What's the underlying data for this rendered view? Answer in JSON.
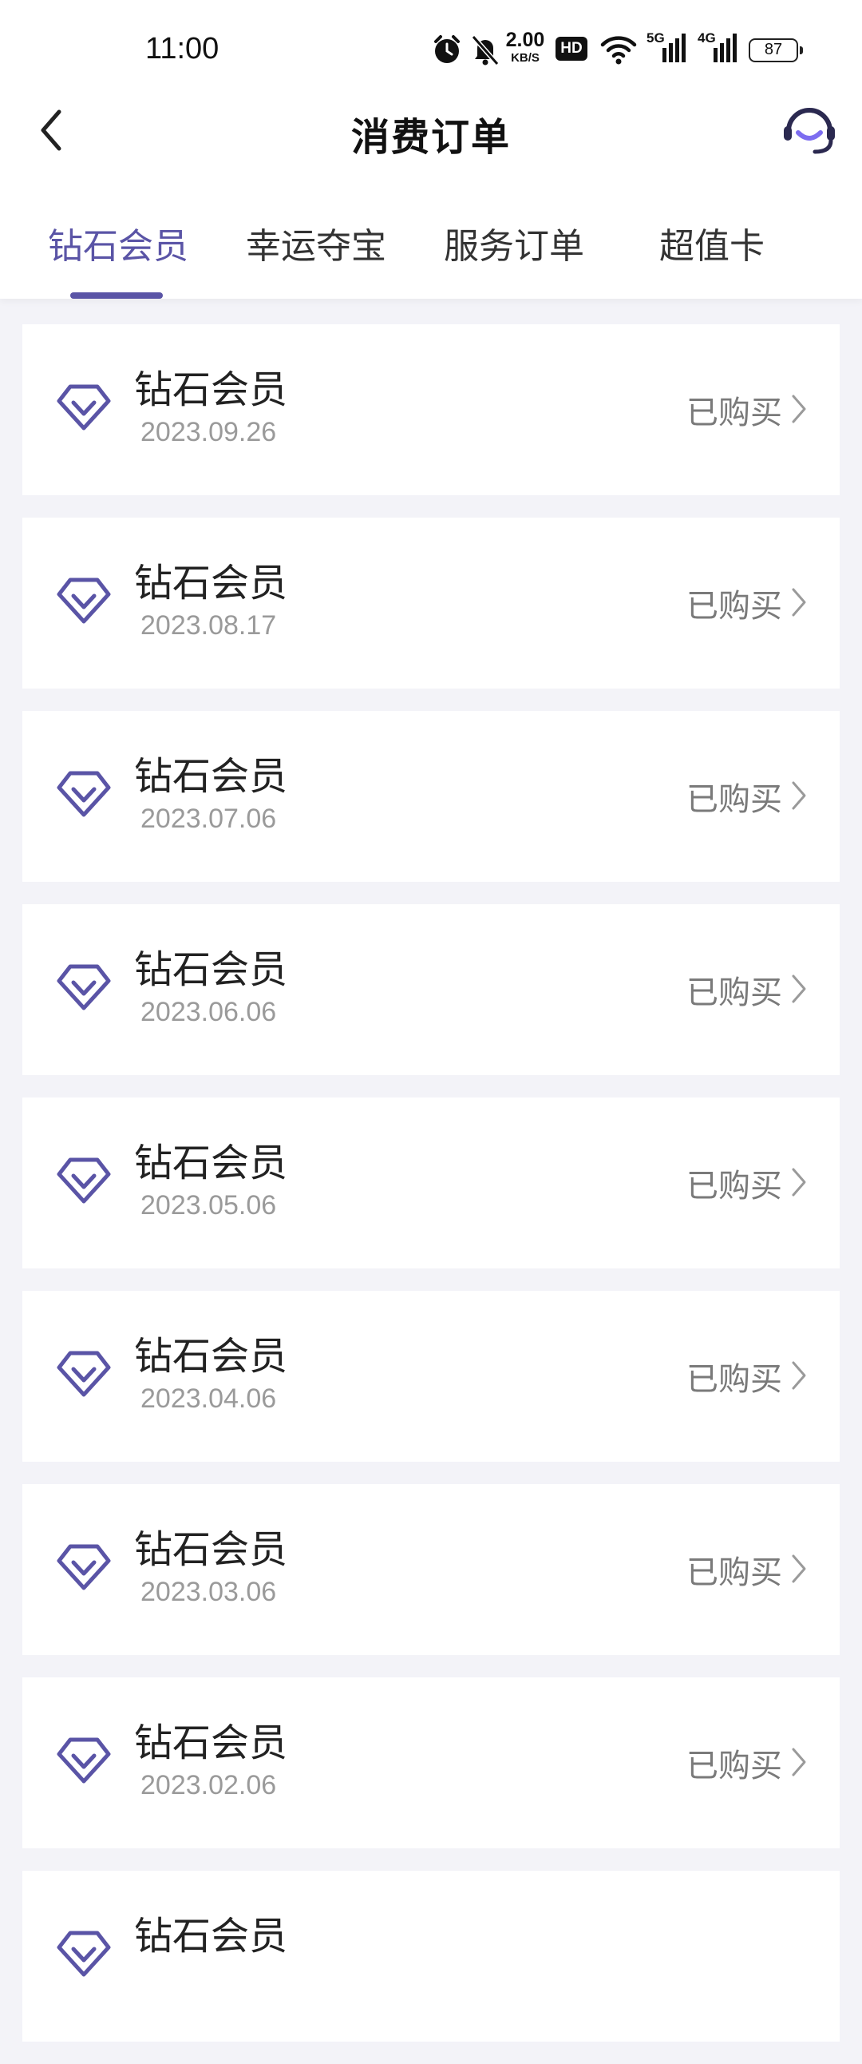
{
  "status_bar": {
    "time": "11:00",
    "net_speed_value": "2.00",
    "net_speed_unit": "KB/S",
    "hd_badge": "HD",
    "signal_1_label": "5G",
    "signal_2_label": "4G",
    "battery": "87",
    "icons": [
      "alarm-icon",
      "mute-icon",
      "hd-icon",
      "wifi-icon",
      "signal-5g-icon",
      "signal-4g-icon",
      "battery-icon"
    ]
  },
  "header": {
    "title": "消费订单",
    "back_icon": "chevron-left-icon",
    "support_icon": "headset-icon"
  },
  "tabs": [
    {
      "label": "钻石会员",
      "active": true
    },
    {
      "label": "幸运夺宝",
      "active": false
    },
    {
      "label": "服务订单",
      "active": false
    },
    {
      "label": "超值卡",
      "active": false
    }
  ],
  "orders": [
    {
      "name": "钻石会员",
      "date": "2023.09.26",
      "status": "已购买"
    },
    {
      "name": "钻石会员",
      "date": "2023.08.17",
      "status": "已购买"
    },
    {
      "name": "钻石会员",
      "date": "2023.07.06",
      "status": "已购买"
    },
    {
      "name": "钻石会员",
      "date": "2023.06.06",
      "status": "已购买"
    },
    {
      "name": "钻石会员",
      "date": "2023.05.06",
      "status": "已购买"
    },
    {
      "name": "钻石会员",
      "date": "2023.04.06",
      "status": "已购买"
    },
    {
      "name": "钻石会员",
      "date": "2023.03.06",
      "status": "已购买"
    },
    {
      "name": "钻石会员",
      "date": "2023.02.06",
      "status": "已购买"
    },
    {
      "name": "钻石会员",
      "date": "",
      "status": ""
    }
  ],
  "colors": {
    "accent": "#5a54a6",
    "background": "#f3f3f8",
    "card": "#ffffff",
    "date_text": "#9a9a9a",
    "status_text": "#7a7a7a"
  }
}
